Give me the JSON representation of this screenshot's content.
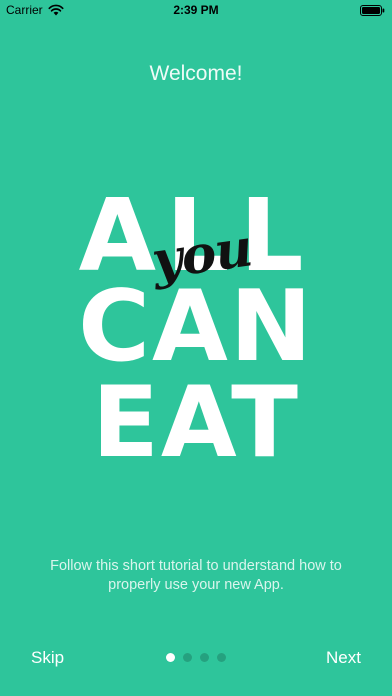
{
  "status_bar": {
    "carrier": "Carrier",
    "time": "2:39 PM",
    "wifi_icon": "wifi-icon",
    "battery_icon": "battery-icon"
  },
  "welcome": "Welcome!",
  "logo": {
    "word_all": "ALL",
    "word_you": "you",
    "word_can": "CAN",
    "word_eat": "EAT"
  },
  "tutorial_text": "Follow this short tutorial to understand how to properly use your new App.",
  "footer": {
    "skip_label": "Skip",
    "next_label": "Next",
    "page_count": 4,
    "current_page": 1
  },
  "colors": {
    "background": "#2ec59b",
    "text": "#ffffff",
    "accent_script": "#111111"
  }
}
